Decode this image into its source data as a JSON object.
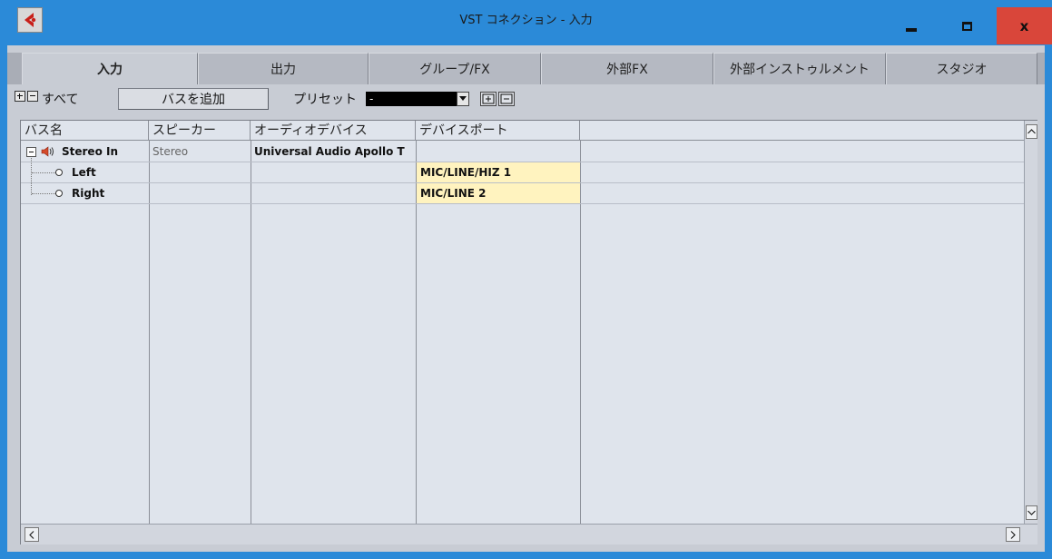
{
  "window": {
    "title": "VST コネクション - 入力",
    "close_label": "x",
    "accent_color": "#2b8ad8"
  },
  "tabs": [
    {
      "label": "入力",
      "active": true
    },
    {
      "label": "出力",
      "active": false
    },
    {
      "label": "グループ/FX",
      "active": false
    },
    {
      "label": "外部FX",
      "active": false
    },
    {
      "label": "外部インストゥルメント",
      "active": false
    },
    {
      "label": "スタジオ",
      "active": false
    }
  ],
  "toolbar": {
    "all_label": "すべて",
    "add_bus_label": "バスを追加",
    "preset_label": "プリセット",
    "preset_value": "-"
  },
  "table": {
    "columns": [
      "バス名",
      "スピーカー",
      "オーディオデバイス",
      "デバイスポート"
    ],
    "rows": [
      {
        "name": "Stereo In",
        "speaker": "Stereo",
        "device": "Universal Audio Apollo T",
        "port": ""
      },
      {
        "name": "Left",
        "speaker": "",
        "device": "",
        "port": "MIC/LINE/HIZ 1"
      },
      {
        "name": "Right",
        "speaker": "",
        "device": "",
        "port": "MIC/LINE 2"
      }
    ]
  },
  "icons": {
    "app_logo": "cubase-logo-icon",
    "speaker": "speaker-icon",
    "port": "port-connector-icon"
  }
}
